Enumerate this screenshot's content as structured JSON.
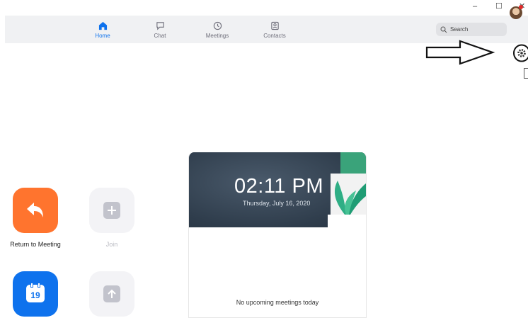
{
  "window": {
    "minimize": "–",
    "maximize": "☐",
    "close": "✕"
  },
  "nav": {
    "tabs": [
      {
        "label": "Home",
        "icon": "home-icon",
        "active": true
      },
      {
        "label": "Chat",
        "icon": "chat-icon",
        "active": false
      },
      {
        "label": "Meetings",
        "icon": "clock-icon",
        "active": false
      },
      {
        "label": "Contacts",
        "icon": "contacts-icon",
        "active": false
      }
    ],
    "search_label": "Search"
  },
  "actions": [
    {
      "label": "Return to Meeting",
      "icon": "return-arrow-icon",
      "color": "#ff742e",
      "enabled": true
    },
    {
      "label": "Join",
      "icon": "plus-icon",
      "color": "#f3f3f6",
      "enabled": false
    },
    {
      "label": "",
      "icon": "calendar-icon",
      "calendar_day": "19",
      "color": "#0e72ed",
      "enabled": true
    },
    {
      "label": "",
      "icon": "share-screen-icon",
      "color": "#f3f3f6",
      "enabled": false
    }
  ],
  "meeting_card": {
    "time": "02:11 PM",
    "date": "Thursday, July 16, 2020",
    "empty_message": "No upcoming meetings today"
  },
  "colors": {
    "accent": "#0e72ed",
    "nav_bg": "#f0f1f3",
    "orange": "#ff742e"
  }
}
